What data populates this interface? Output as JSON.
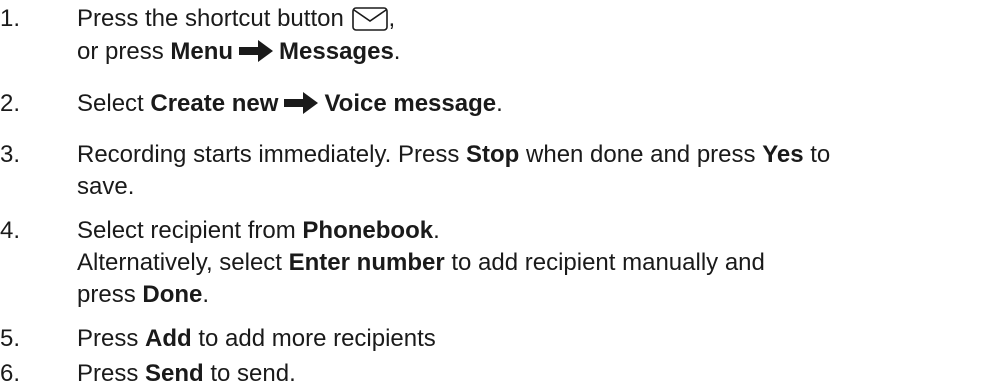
{
  "steps": [
    {
      "number": "1.",
      "line1": {
        "text": "Press the shortcut button",
        "icon": "envelope-icon",
        "after": ","
      },
      "line2": {
        "pre": "or press ",
        "menu": "Menu",
        "target": "Messages",
        "post": "."
      }
    },
    {
      "number": "2.",
      "line1": {
        "pre": "Select ",
        "option": "Create new",
        "target": "Voice message",
        "post": "."
      }
    },
    {
      "number": "3.",
      "line1": {
        "t1": "Recording starts immediately. Press ",
        "stop": "Stop",
        "t2": " when done and press ",
        "yes": "Yes",
        "t3": " to"
      },
      "line2": {
        "text": "save."
      }
    },
    {
      "number": "4.",
      "line1": {
        "pre": "Select recipient from ",
        "phonebook": "Phonebook",
        "post": "."
      },
      "line2": {
        "pre": "Alternatively, select ",
        "enter_number": "Enter number",
        "post": " to add recipient manually and"
      },
      "line3": {
        "pre": "press ",
        "done": "Done",
        "post": "."
      }
    },
    {
      "number": "5.",
      "line1": {
        "pre": "Press ",
        "add": "Add",
        "post": " to add more recipients"
      }
    },
    {
      "number": "6.",
      "line1": {
        "pre": "Press ",
        "send": "Send",
        "post": " to send."
      }
    }
  ]
}
